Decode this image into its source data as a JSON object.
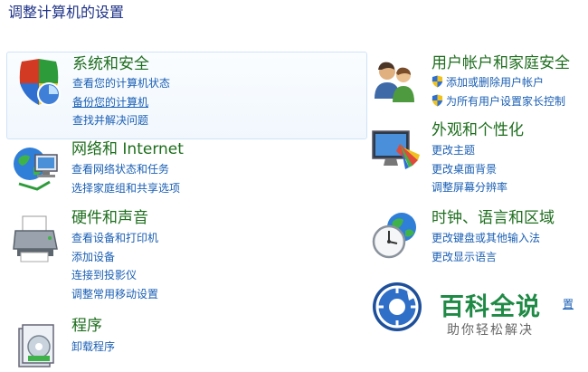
{
  "page": {
    "title": "调整计算机的设置"
  },
  "categories": {
    "system": {
      "title": "系统和安全",
      "icon": "shield-icon",
      "links": [
        "查看您的计算机状态",
        "备份您的计算机",
        "查找并解决问题"
      ]
    },
    "network": {
      "title": "网络和 Internet",
      "icon": "network-globe-icon",
      "links": [
        "查看网络状态和任务",
        "选择家庭组和共享选项"
      ]
    },
    "hardware": {
      "title": "硬件和声音",
      "icon": "printer-icon",
      "links": [
        "查看设备和打印机",
        "添加设备",
        "连接到投影仪",
        "调整常用移动设置"
      ]
    },
    "programs": {
      "title": "程序",
      "icon": "programs-icon",
      "links": [
        "卸载程序"
      ]
    },
    "users": {
      "title": "用户帐户和家庭安全",
      "icon": "users-icon",
      "links": [
        "添加或删除用户帐户",
        "为所有用户设置家长控制"
      ]
    },
    "appearance": {
      "title": "外观和个性化",
      "icon": "monitor-palette-icon",
      "links": [
        "更改主题",
        "更改桌面背景",
        "调整屏幕分辨率"
      ]
    },
    "clock": {
      "title": "时钟、语言和区域",
      "icon": "clock-globe-icon",
      "links": [
        "更改键盘或其他输入法",
        "更改显示语言"
      ]
    },
    "ease": {
      "icon": "ease-of-access-icon",
      "clipped_link": "置"
    }
  },
  "watermark": {
    "title": "百科全说",
    "subtitle": "助你轻松解决"
  },
  "colors": {
    "title": "#1e3287",
    "category_title": "#1e6e1e",
    "link": "#1a5fb4",
    "hover_border": "#cfe3f7",
    "watermark_green": "#1f8a45"
  }
}
